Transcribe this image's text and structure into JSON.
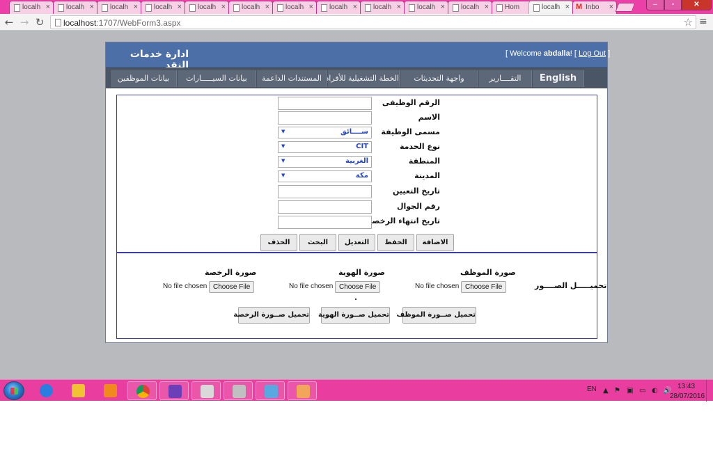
{
  "browser": {
    "tabs": [
      {
        "title": "localh",
        "icon": "page-icon",
        "active": false
      },
      {
        "title": "localh",
        "icon": "page-icon",
        "active": false
      },
      {
        "title": "localh",
        "icon": "page-icon",
        "active": false
      },
      {
        "title": "localh",
        "icon": "page-icon",
        "active": false
      },
      {
        "title": "localh",
        "icon": "page-icon",
        "active": false
      },
      {
        "title": "localh",
        "icon": "page-icon",
        "active": false
      },
      {
        "title": "localh",
        "icon": "page-icon",
        "active": false
      },
      {
        "title": "localh",
        "icon": "page-icon",
        "active": false
      },
      {
        "title": "localh",
        "icon": "page-icon",
        "active": false
      },
      {
        "title": "localh",
        "icon": "page-icon",
        "active": false
      },
      {
        "title": "localh",
        "icon": "page-icon",
        "active": false
      },
      {
        "title": "Hom",
        "icon": "page-icon",
        "active": false
      },
      {
        "title": "localh",
        "icon": "page-icon",
        "active": true
      },
      {
        "title": "Inbo",
        "icon": "gmail-icon",
        "active": false
      }
    ],
    "tab_close_glyph": "×",
    "window_controls": {
      "minimize": "–",
      "maximize": "▫",
      "close": "✕"
    },
    "nav": {
      "back": "←",
      "forward": "→",
      "reload": "↻"
    },
    "url_host": "localhost",
    "url_rest": ":1707/WebForm3.aspx",
    "star": "☆",
    "menu": "≡"
  },
  "page": {
    "site_title": "ادارة خدمات النقد",
    "login": {
      "prefix": "[ Welcome ",
      "username": "abdalla",
      "suffix": "! [ ",
      "logout_label": "Log Out",
      "close_bracket": " ]"
    },
    "menu": [
      {
        "label": "English"
      },
      {
        "label": "التقــــارير"
      },
      {
        "label": "واجهة التحديثات"
      },
      {
        "label": "الخطة التشغيلية للأفراد"
      },
      {
        "label": "المستندات الداعمة"
      },
      {
        "label": "بيانات السيـــــارات"
      },
      {
        "label": "بيانات الموظفين"
      }
    ],
    "form": {
      "employee_no_label": "الرقم الوظيفى",
      "employee_no_value": "",
      "name_label": "الاسم",
      "name_value": "",
      "job_title_label": "مسمى الوظيفة",
      "job_title_value": "ســــائق",
      "service_type_label": "نوع الخدمة",
      "service_type_value": "CIT",
      "region_label": "المنطقة",
      "region_value": "الغربية",
      "city_label": "المدينة",
      "city_value": "مكة",
      "hire_date_label": "تاريخ التعيين",
      "hire_date_value": "",
      "mobile_label": "رقم الجوال",
      "mobile_value": "",
      "license_expiry_label": "تاريخ انتهاء الرخصة",
      "license_expiry_value": "",
      "select_arrow": "▼"
    },
    "actions": {
      "add": "الاضافة",
      "save": "الحفظ",
      "edit": "التعديل",
      "search": "البحث",
      "delete": "الحذف"
    },
    "uploads": {
      "section_label": "تحميـــــل الصــــور",
      "employee_photo_label": "صورة الموظف",
      "id_photo_label": "صورة الهوية",
      "license_photo_label": "صورة  الرخصة",
      "no_file_text": "No file chosen",
      "choose_file_label": "Choose File",
      "upload_employee_label": "تحميل صــورة الموظف",
      "upload_id_label": "تحميل صــورة الهوية",
      "upload_license_label": "تحميل صــورة الرخصة"
    }
  },
  "taskbar": {
    "apps": [
      {
        "icon": "internet-explorer-icon",
        "color": "#2a7ee0"
      },
      {
        "icon": "file-explorer-icon",
        "color": "#f1c232"
      },
      {
        "icon": "media-player-icon",
        "color": "#f08a1c"
      },
      {
        "icon": "chrome-icon",
        "color": "#3c9a3c"
      },
      {
        "icon": "visual-studio-icon",
        "color": "#6a3fb8"
      },
      {
        "icon": "paint-tools-icon",
        "color": "#d9d9d9"
      },
      {
        "icon": "snipping-tool-icon",
        "color": "#c0c0c0"
      },
      {
        "icon": "notebook-icon",
        "color": "#5aa8e0"
      },
      {
        "icon": "paint-icon",
        "color": "#f2a65a"
      }
    ],
    "language": "EN",
    "tray_up": "▲",
    "tray_icons": [
      "⚑",
      "▣",
      "▭",
      "◐",
      "🔊"
    ],
    "time": "13:43",
    "date": "28/07/2016"
  }
}
